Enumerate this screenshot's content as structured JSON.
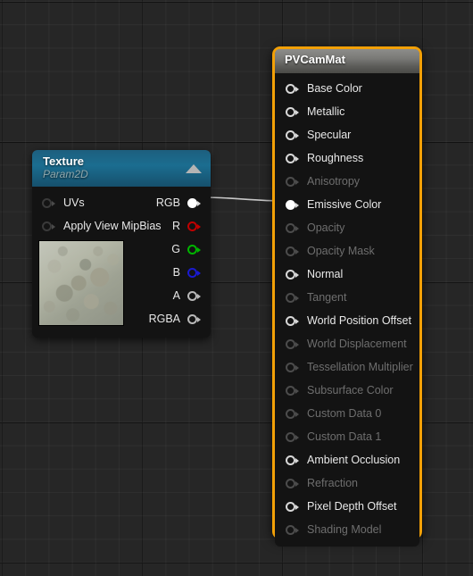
{
  "editor": {
    "name": "material-graph-editor",
    "background_color": "#262626",
    "grid_minor_color": "#2f2f2f",
    "grid_major_color": "#111111"
  },
  "wire": {
    "color": "#c8c8c8",
    "from": "Texture.RGB",
    "to": "PVCamMat.Emissive Color"
  },
  "texture_node": {
    "title": "Texture",
    "subtitle": "Param2D",
    "header_color": "#1b6d90",
    "collapse_icon": "triangle-up-icon",
    "inputs": [
      {
        "label": "UVs",
        "connected": false
      },
      {
        "label": "Apply View MipBias",
        "connected": false
      }
    ],
    "outputs": [
      {
        "label": "RGB",
        "color": "#ffffff",
        "connected": true
      },
      {
        "label": "R",
        "color": "#c00000",
        "connected": false
      },
      {
        "label": "G",
        "color": "#00b400",
        "connected": false
      },
      {
        "label": "B",
        "color": "#1a1ad0",
        "connected": false
      },
      {
        "label": "A",
        "color": "#b9b9b9",
        "connected": false
      },
      {
        "label": "RGBA",
        "color": "#b9b9b9",
        "connected": false
      }
    ],
    "thumbnail_alt": "texture-preview-thumbnail"
  },
  "material_node": {
    "title": "PVCamMat",
    "selected": true,
    "selection_color": "#f2a007",
    "header_color": "#7a7a77",
    "inputs": [
      {
        "label": "Base Color",
        "enabled": true,
        "connected": false
      },
      {
        "label": "Metallic",
        "enabled": true,
        "connected": false
      },
      {
        "label": "Specular",
        "enabled": true,
        "connected": false
      },
      {
        "label": "Roughness",
        "enabled": true,
        "connected": false
      },
      {
        "label": "Anisotropy",
        "enabled": false,
        "connected": false
      },
      {
        "label": "Emissive Color",
        "enabled": true,
        "connected": true
      },
      {
        "label": "Opacity",
        "enabled": false,
        "connected": false
      },
      {
        "label": "Opacity Mask",
        "enabled": false,
        "connected": false
      },
      {
        "label": "Normal",
        "enabled": true,
        "connected": false
      },
      {
        "label": "Tangent",
        "enabled": false,
        "connected": false
      },
      {
        "label": "World Position Offset",
        "enabled": true,
        "connected": false
      },
      {
        "label": "World Displacement",
        "enabled": false,
        "connected": false
      },
      {
        "label": "Tessellation Multiplier",
        "enabled": false,
        "connected": false
      },
      {
        "label": "Subsurface Color",
        "enabled": false,
        "connected": false
      },
      {
        "label": "Custom Data 0",
        "enabled": false,
        "connected": false
      },
      {
        "label": "Custom Data 1",
        "enabled": false,
        "connected": false
      },
      {
        "label": "Ambient Occlusion",
        "enabled": true,
        "connected": false
      },
      {
        "label": "Refraction",
        "enabled": false,
        "connected": false
      },
      {
        "label": "Pixel Depth Offset",
        "enabled": true,
        "connected": false
      },
      {
        "label": "Shading Model",
        "enabled": false,
        "connected": false
      }
    ]
  }
}
